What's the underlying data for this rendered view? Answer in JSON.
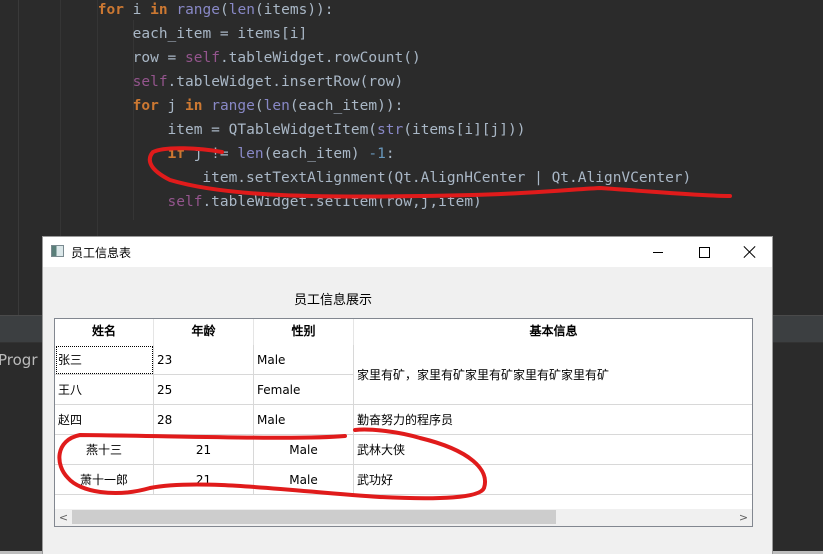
{
  "editor": {
    "code_lines": [
      {
        "indent": 8,
        "tokens": [
          [
            "kw",
            "for"
          ],
          [
            "",
            "i "
          ],
          [
            "kw",
            "in"
          ],
          [
            "",
            ""
          ],
          [
            "bi",
            "range"
          ],
          [
            "",
            "("
          ],
          [
            "bi",
            "len"
          ],
          [
            "",
            "(items)):"
          ]
        ]
      },
      {
        "indent": 12,
        "tokens": [
          [
            "",
            "each_item = items[i]"
          ]
        ]
      },
      {
        "indent": 12,
        "tokens": [
          [
            "",
            "row = "
          ],
          [
            "self",
            "self"
          ],
          [
            "",
            ".tableWidget.rowCount()"
          ]
        ]
      },
      {
        "indent": 12,
        "tokens": [
          [
            "self",
            "self"
          ],
          [
            "",
            ".tableWidget.insertRow(row)"
          ]
        ]
      },
      {
        "indent": 12,
        "tokens": [
          [
            "kw",
            "for"
          ],
          [
            "",
            "j "
          ],
          [
            "kw",
            "in"
          ],
          [
            "",
            ""
          ],
          [
            "bi",
            "range"
          ],
          [
            "",
            "("
          ],
          [
            "bi",
            "len"
          ],
          [
            "",
            "(each_item)):"
          ]
        ]
      },
      {
        "indent": 16,
        "tokens": [
          [
            "",
            "item = QTableWidgetItem("
          ],
          [
            "bi",
            "str"
          ],
          [
            "",
            "(items[i][j]))"
          ]
        ]
      },
      {
        "indent": 16,
        "tokens": [
          [
            "kw",
            "if"
          ],
          [
            "",
            "j != "
          ],
          [
            "bi",
            "len"
          ],
          [
            "",
            "(each_item) "
          ],
          [
            "num",
            "-1"
          ],
          [
            "",
            ":"
          ]
        ]
      },
      {
        "indent": 20,
        "tokens": [
          [
            "",
            "item.setTextAlignment(Qt.AlignHCenter | Qt.AlignVCenter)"
          ]
        ]
      },
      {
        "indent": 16,
        "tokens": [
          [
            "self",
            "self"
          ],
          [
            "",
            ".tableWidget.setItem(row,j,item)"
          ]
        ]
      }
    ]
  },
  "bottom_panel": {
    "truncated_label": "Progr"
  },
  "window": {
    "title": "员工信息表",
    "minimize_label": "minimize",
    "maximize_label": "maximize",
    "close_label": "close",
    "heading": "员工信息展示",
    "table": {
      "columns": [
        "姓名",
        "年龄",
        "性别",
        "基本信息"
      ],
      "rows": [
        {
          "name": "张三",
          "age": "23",
          "gender": "Male",
          "info": "家里有矿，家里有矿家里有矿家里有矿家里有矿",
          "centered": false,
          "focused": true,
          "info_span": 2
        },
        {
          "name": "王八",
          "age": "25",
          "gender": "Female",
          "info": null,
          "centered": false,
          "focused": false
        },
        {
          "name": "赵四",
          "age": "28",
          "gender": "Male",
          "info": "勤奋努力的程序员",
          "centered": false,
          "focused": false
        },
        {
          "name": "燕十三",
          "age": "21",
          "gender": "Male",
          "info": "武林大侠",
          "centered": true,
          "focused": false
        },
        {
          "name": "萧十一郎",
          "age": "21",
          "gender": "Male",
          "info": "武功好",
          "centered": true,
          "focused": false
        }
      ],
      "scroll_left": "<",
      "scroll_right": ">",
      "scroll_fraction_visible": 0.73
    }
  },
  "annotation_color": "#e01b1b"
}
